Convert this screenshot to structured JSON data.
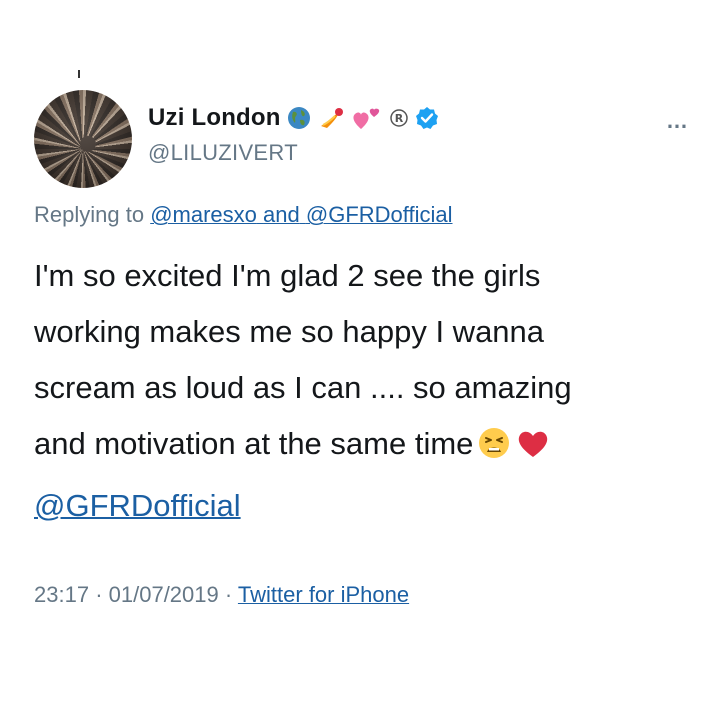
{
  "user": {
    "display_name": "Uzi London",
    "handle": "@LILUZIVERT"
  },
  "header": {
    "more_label": "…",
    "name_emojis": [
      "globe-icon",
      "fire-icon",
      "hearts-icon",
      "registered-icon",
      "verified-badge-icon"
    ]
  },
  "reply": {
    "prefix": "Replying to",
    "mention_1": "@maresxo",
    "connector": "and",
    "mention_2": "@GFRDofficial"
  },
  "tweet": {
    "lines": [
      "I'm so excited I'm glad 2 see the girls",
      "working makes me so happy I wanna",
      "scream as loud as I can .... so amazing",
      "and motivation at the same time"
    ],
    "trailing_emojis": [
      "tired-face-icon",
      "red-heart-icon"
    ],
    "mention": "@GFRDofficial"
  },
  "meta": {
    "time": "23:17",
    "separator_1": "·",
    "date": "01/07/2019",
    "separator_2": "·",
    "source": "Twitter for iPhone"
  },
  "colors": {
    "link": "#1b5fa3",
    "muted": "#657786",
    "text": "#14171a",
    "verified": "#1da1f2"
  }
}
